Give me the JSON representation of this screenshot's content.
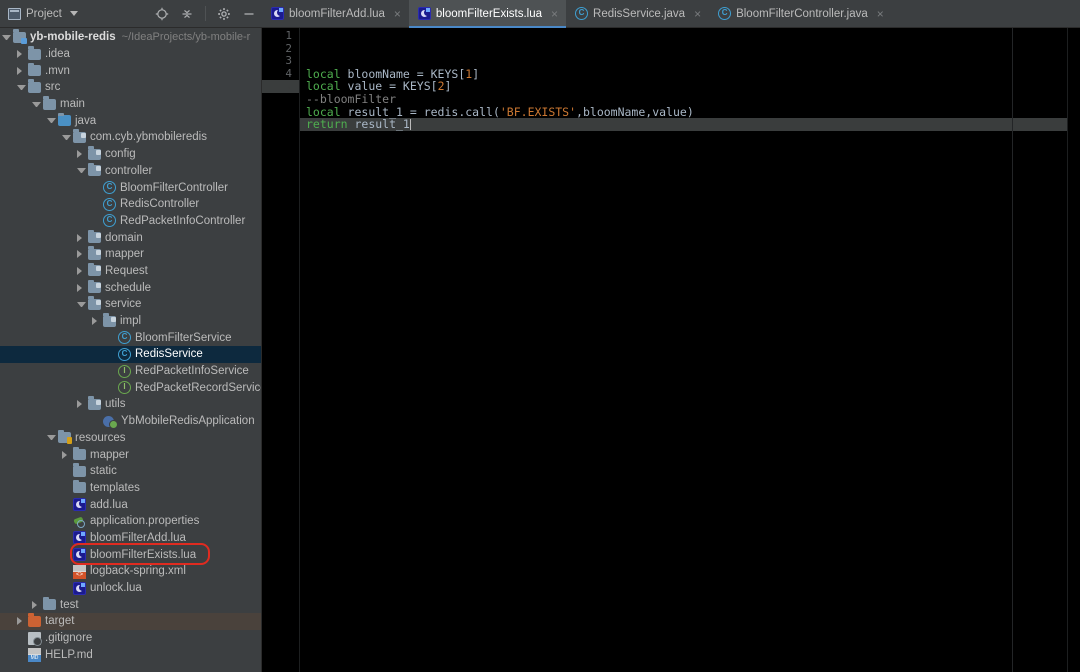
{
  "project_panel": {
    "title": "Project",
    "dropdown_icon": "chevron-down-icon",
    "toolbar_icons": [
      "locate-target-icon",
      "collapse-all-icon",
      "gear-icon",
      "hide-icon"
    ]
  },
  "tabs": [
    {
      "label": "bloomFilterAdd.lua",
      "icon": "lua-file-icon",
      "active": false,
      "close": "×"
    },
    {
      "label": "bloomFilterExists.lua",
      "icon": "lua-file-icon",
      "active": true,
      "close": "×"
    },
    {
      "label": "RedisService.java",
      "icon": "java-class-icon",
      "active": false,
      "close": "×"
    },
    {
      "label": "BloomFilterController.java",
      "icon": "java-class-icon",
      "active": false,
      "close": "×"
    }
  ],
  "tree": {
    "root": {
      "label": "yb-mobile-redis",
      "path": "~/IdeaProjects/yb-mobile-r"
    },
    "items": [
      {
        "label": ".idea",
        "depth": 1,
        "arrow": "right",
        "icon": "folder"
      },
      {
        "label": ".mvn",
        "depth": 1,
        "arrow": "right",
        "icon": "folder"
      },
      {
        "label": "src",
        "depth": 1,
        "arrow": "down",
        "icon": "folder"
      },
      {
        "label": "main",
        "depth": 2,
        "arrow": "down",
        "icon": "folder"
      },
      {
        "label": "java",
        "depth": 3,
        "arrow": "down",
        "icon": "folder-source"
      },
      {
        "label": "com.cyb.ybmobileredis",
        "depth": 4,
        "arrow": "down",
        "icon": "folder-package"
      },
      {
        "label": "config",
        "depth": 5,
        "arrow": "right",
        "icon": "folder-package"
      },
      {
        "label": "controller",
        "depth": 5,
        "arrow": "down",
        "icon": "folder-package"
      },
      {
        "label": "BloomFilterController",
        "depth": 6,
        "arrow": "none",
        "icon": "java-class"
      },
      {
        "label": "RedisController",
        "depth": 6,
        "arrow": "none",
        "icon": "java-class"
      },
      {
        "label": "RedPacketInfoController",
        "depth": 6,
        "arrow": "none",
        "icon": "java-class"
      },
      {
        "label": "domain",
        "depth": 5,
        "arrow": "right",
        "icon": "folder-package"
      },
      {
        "label": "mapper",
        "depth": 5,
        "arrow": "right",
        "icon": "folder-package"
      },
      {
        "label": "Request",
        "depth": 5,
        "arrow": "right",
        "icon": "folder-package"
      },
      {
        "label": "schedule",
        "depth": 5,
        "arrow": "right",
        "icon": "folder-package"
      },
      {
        "label": "service",
        "depth": 5,
        "arrow": "down",
        "icon": "folder-package"
      },
      {
        "label": "impl",
        "depth": 6,
        "arrow": "right",
        "icon": "folder-package"
      },
      {
        "label": "BloomFilterService",
        "depth": 7,
        "arrow": "none",
        "icon": "java-class"
      },
      {
        "label": "RedisService",
        "depth": 7,
        "arrow": "none",
        "icon": "java-class",
        "selected": true
      },
      {
        "label": "RedPacketInfoService",
        "depth": 7,
        "arrow": "none",
        "icon": "java-interface"
      },
      {
        "label": "RedPacketRecordService",
        "depth": 7,
        "arrow": "none",
        "icon": "java-interface"
      },
      {
        "label": "utils",
        "depth": 5,
        "arrow": "right",
        "icon": "folder-package"
      },
      {
        "label": "YbMobileRedisApplication",
        "depth": 6,
        "arrow": "none",
        "icon": "spring-boot"
      },
      {
        "label": "resources",
        "depth": 3,
        "arrow": "down",
        "icon": "folder-resources"
      },
      {
        "label": "mapper",
        "depth": 4,
        "arrow": "right",
        "icon": "folder"
      },
      {
        "label": "static",
        "depth": 4,
        "arrow": "none",
        "icon": "folder"
      },
      {
        "label": "templates",
        "depth": 4,
        "arrow": "none",
        "icon": "folder"
      },
      {
        "label": "add.lua",
        "depth": 4,
        "arrow": "none",
        "icon": "lua-file"
      },
      {
        "label": "application.properties",
        "depth": 4,
        "arrow": "none",
        "icon": "properties-file"
      },
      {
        "label": "bloomFilterAdd.lua",
        "depth": 4,
        "arrow": "none",
        "icon": "lua-file"
      },
      {
        "label": "bloomFilterExists.lua",
        "depth": 4,
        "arrow": "none",
        "icon": "lua-file",
        "annotated": true
      },
      {
        "label": "logback-spring.xml",
        "depth": 4,
        "arrow": "none",
        "icon": "xml-file"
      },
      {
        "label": "unlock.lua",
        "depth": 4,
        "arrow": "none",
        "icon": "lua-file"
      },
      {
        "label": "test",
        "depth": 2,
        "arrow": "right",
        "icon": "folder"
      },
      {
        "label": "target",
        "depth": 1,
        "arrow": "right",
        "icon": "folder-excluded",
        "highlighted": true
      },
      {
        "label": ".gitignore",
        "depth": 1,
        "arrow": "none",
        "icon": "gitignore-file"
      },
      {
        "label": "HELP.md",
        "depth": 1,
        "arrow": "none",
        "icon": "markdown-file"
      }
    ]
  },
  "editor": {
    "line_numbers": [
      "1",
      "2",
      "3",
      "4"
    ],
    "caret_line_index": 4,
    "lines": [
      {
        "tokens": [
          {
            "t": "local ",
            "c": "kw"
          },
          {
            "t": "bloomName = KEYS[",
            "c": "plain"
          },
          {
            "t": "1",
            "c": "num"
          },
          {
            "t": "]",
            "c": "plain"
          }
        ]
      },
      {
        "tokens": [
          {
            "t": "local ",
            "c": "kw"
          },
          {
            "t": "value = KEYS[",
            "c": "plain"
          },
          {
            "t": "2",
            "c": "num"
          },
          {
            "t": "]",
            "c": "plain"
          }
        ]
      },
      {
        "tokens": [
          {
            "t": "--bloomFilter",
            "c": "com"
          }
        ]
      },
      {
        "tokens": [
          {
            "t": "local ",
            "c": "kw"
          },
          {
            "t": "result_1 = redis.call(",
            "c": "plain"
          },
          {
            "t": "'BF.EXISTS'",
            "c": "str"
          },
          {
            "t": ",bloomName,value)",
            "c": "plain"
          }
        ]
      },
      {
        "tokens": [
          {
            "t": "return ",
            "c": "kw"
          },
          {
            "t": "result_1",
            "c": "plain"
          }
        ],
        "caret": true
      }
    ]
  },
  "colors": {
    "panel_bg": "#3c3f41",
    "editor_bg": "#000000",
    "selection": "#0d293e",
    "annotation_red": "#e02b20",
    "tab_active_underline": "#4a88c7",
    "caret_line": "#3a3d3d",
    "target_row": "#4a423c"
  }
}
